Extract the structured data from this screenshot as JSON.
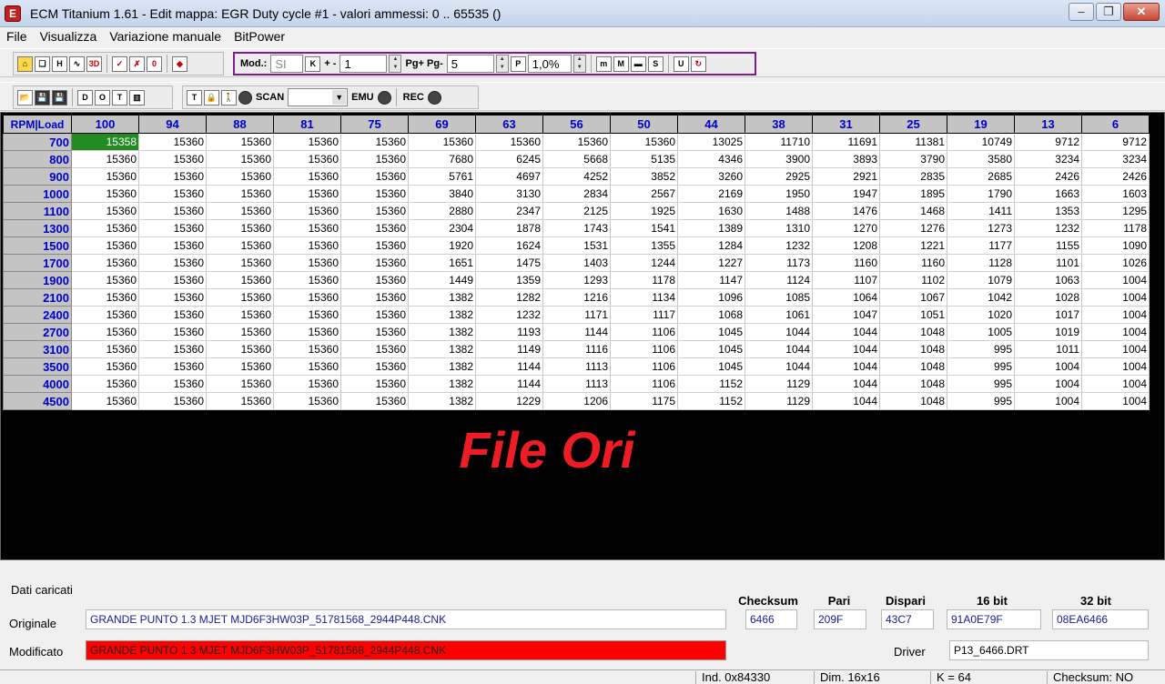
{
  "window": {
    "title": "ECM Titanium 1.61 - Edit mappa: EGR Duty cycle #1 - valori ammessi: 0 .. 65535 ()",
    "minimize": "‒",
    "maximize": "❐",
    "close": "✕"
  },
  "menu": [
    "File",
    "Visualizza",
    "Variazione manuale",
    "BitPower"
  ],
  "toolbar": {
    "mod_label": "Mod.:",
    "mod_value": "SI",
    "k_btn": "K",
    "plusminus_label": "+ -",
    "plusminus_value": "1",
    "pg_label": "Pg+ Pg-",
    "pg_value": "5",
    "p_btn": "P",
    "percent_value": "1,0%",
    "scan_label": "SCAN",
    "emu_label": "EMU",
    "rec_label": "REC",
    "buttons_row1": [
      "⌂",
      "❏",
      "H",
      "∿",
      "3D",
      "✓",
      "✗",
      "0",
      "◆"
    ],
    "buttons_row2": [
      "📂",
      "💾",
      "💾",
      "D",
      "O",
      "T",
      "▥",
      "T",
      "🔒",
      "🚶",
      "●"
    ],
    "extra_btns": [
      "m",
      "M",
      "▬",
      "S",
      "U",
      "↻"
    ]
  },
  "grid": {
    "corner": "RPM|Load",
    "load_headers": [
      "100",
      "94",
      "88",
      "81",
      "75",
      "69",
      "63",
      "56",
      "50",
      "44",
      "38",
      "31",
      "25",
      "19",
      "13",
      "6"
    ],
    "rpm_headers": [
      "700",
      "800",
      "900",
      "1000",
      "1100",
      "1300",
      "1500",
      "1700",
      "1900",
      "2100",
      "2400",
      "2700",
      "3100",
      "3500",
      "4000",
      "4500"
    ],
    "rows": [
      [
        "15358",
        "15360",
        "15360",
        "15360",
        "15360",
        "15360",
        "15360",
        "15360",
        "15360",
        "13025",
        "11710",
        "11691",
        "11381",
        "10749",
        "9712",
        "9712"
      ],
      [
        "15360",
        "15360",
        "15360",
        "15360",
        "15360",
        "7680",
        "6245",
        "5668",
        "5135",
        "4346",
        "3900",
        "3893",
        "3790",
        "3580",
        "3234",
        "3234"
      ],
      [
        "15360",
        "15360",
        "15360",
        "15360",
        "15360",
        "5761",
        "4697",
        "4252",
        "3852",
        "3260",
        "2925",
        "2921",
        "2835",
        "2685",
        "2426",
        "2426"
      ],
      [
        "15360",
        "15360",
        "15360",
        "15360",
        "15360",
        "3840",
        "3130",
        "2834",
        "2567",
        "2169",
        "1950",
        "1947",
        "1895",
        "1790",
        "1663",
        "1603"
      ],
      [
        "15360",
        "15360",
        "15360",
        "15360",
        "15360",
        "2880",
        "2347",
        "2125",
        "1925",
        "1630",
        "1488",
        "1476",
        "1468",
        "1411",
        "1353",
        "1295"
      ],
      [
        "15360",
        "15360",
        "15360",
        "15360",
        "15360",
        "2304",
        "1878",
        "1743",
        "1541",
        "1389",
        "1310",
        "1270",
        "1276",
        "1273",
        "1232",
        "1178"
      ],
      [
        "15360",
        "15360",
        "15360",
        "15360",
        "15360",
        "1920",
        "1624",
        "1531",
        "1355",
        "1284",
        "1232",
        "1208",
        "1221",
        "1177",
        "1155",
        "1090"
      ],
      [
        "15360",
        "15360",
        "15360",
        "15360",
        "15360",
        "1651",
        "1475",
        "1403",
        "1244",
        "1227",
        "1173",
        "1160",
        "1160",
        "1128",
        "1101",
        "1026"
      ],
      [
        "15360",
        "15360",
        "15360",
        "15360",
        "15360",
        "1449",
        "1359",
        "1293",
        "1178",
        "1147",
        "1124",
        "1107",
        "1102",
        "1079",
        "1063",
        "1004"
      ],
      [
        "15360",
        "15360",
        "15360",
        "15360",
        "15360",
        "1382",
        "1282",
        "1216",
        "1134",
        "1096",
        "1085",
        "1064",
        "1067",
        "1042",
        "1028",
        "1004"
      ],
      [
        "15360",
        "15360",
        "15360",
        "15360",
        "15360",
        "1382",
        "1232",
        "1171",
        "1117",
        "1068",
        "1061",
        "1047",
        "1051",
        "1020",
        "1017",
        "1004"
      ],
      [
        "15360",
        "15360",
        "15360",
        "15360",
        "15360",
        "1382",
        "1193",
        "1144",
        "1106",
        "1045",
        "1044",
        "1044",
        "1048",
        "1005",
        "1019",
        "1004"
      ],
      [
        "15360",
        "15360",
        "15360",
        "15360",
        "15360",
        "1382",
        "1149",
        "1116",
        "1106",
        "1045",
        "1044",
        "1044",
        "1048",
        "995",
        "1011",
        "1004"
      ],
      [
        "15360",
        "15360",
        "15360",
        "15360",
        "15360",
        "1382",
        "1144",
        "1113",
        "1106",
        "1045",
        "1044",
        "1044",
        "1048",
        "995",
        "1004",
        "1004"
      ],
      [
        "15360",
        "15360",
        "15360",
        "15360",
        "15360",
        "1382",
        "1144",
        "1113",
        "1106",
        "1152",
        "1129",
        "1044",
        "1048",
        "995",
        "1004",
        "1004"
      ],
      [
        "15360",
        "15360",
        "15360",
        "15360",
        "15360",
        "1382",
        "1229",
        "1206",
        "1175",
        "1152",
        "1129",
        "1044",
        "1048",
        "995",
        "1004",
        "1004"
      ]
    ],
    "selected_cell": "15358",
    "overlay_label": "File Ori"
  },
  "loaded": {
    "section_title": "Dati caricati",
    "original_label": "Originale",
    "original_file": "GRANDE PUNTO 1.3 MJET MJD6F3HW03P_51781568_2944P448.CNK",
    "modified_label": "Modificato",
    "modified_file": "GRANDE PUNTO 1.3 MJET MJD6F3HW03P_51781568_2944P448.CNK",
    "checksum_label": "Checksum",
    "checksum_value": "6466",
    "pari_label": "Pari",
    "pari_value": "209F",
    "dispari_label": "Dispari",
    "dispari_value": "43C7",
    "bit16_label": "16 bit",
    "bit16_value": "91A0E79F",
    "bit32_label": "32 bit",
    "bit32_value": "08EA6466",
    "driver_label": "Driver",
    "driver_value": "P13_6466.DRT"
  },
  "status": {
    "ind": "Ind. 0x84330",
    "dim": "Dim. 16x16",
    "k": "K = 64",
    "checksum": "Checksum: NO"
  },
  "colors": {
    "selected_cell": "#228b22",
    "overlay_text": "#ee1c24",
    "modified_field": "#ff0000",
    "header_text": "#0000cc"
  }
}
